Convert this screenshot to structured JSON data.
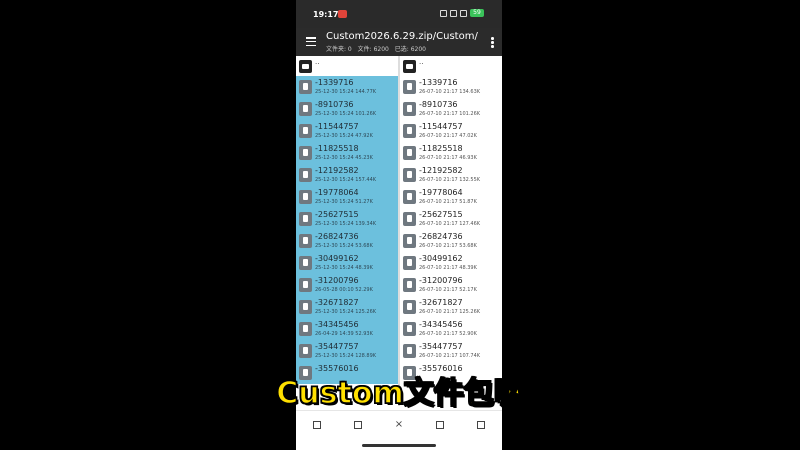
{
  "status_bar": {
    "time": "19:17",
    "battery": "59"
  },
  "app_bar": {
    "title": "Custom2026.6.29.zip/Custom/",
    "folders": "文件夹: 0",
    "files": "文件: 6200",
    "selected": "已选: 6200"
  },
  "left_pane": {
    "parent": "..",
    "files": [
      {
        "name": "-1339716",
        "meta": "25-12-30 15:24  144.77K"
      },
      {
        "name": "-8910736",
        "meta": "25-12-30 15:24  101.26K"
      },
      {
        "name": "-11544757",
        "meta": "25-12-30 15:24  47.92K"
      },
      {
        "name": "-11825518",
        "meta": "25-12-30 15:24  45.23K"
      },
      {
        "name": "-12192582",
        "meta": "25-12-30 15:24  157.44K"
      },
      {
        "name": "-19778064",
        "meta": "25-12-30 15:24  51.27K"
      },
      {
        "name": "-25627515",
        "meta": "25-12-30 15:24  139.34K"
      },
      {
        "name": "-26824736",
        "meta": "25-12-30 15:24  53.68K"
      },
      {
        "name": "-30499162",
        "meta": "25-12-30 15:24  48.39K"
      },
      {
        "name": "-31200796",
        "meta": "26-05-28 00:10  52.29K"
      },
      {
        "name": "-32671827",
        "meta": "25-12-30 15:24  125.26K"
      },
      {
        "name": "-34345456",
        "meta": "26-04-29 14:39  52.93K"
      },
      {
        "name": "-35447757",
        "meta": "25-12-30 15:24  128.89K"
      },
      {
        "name": "-35576016",
        "meta": ""
      }
    ]
  },
  "right_pane": {
    "parent": "..",
    "files": [
      {
        "name": "-1339716",
        "meta": "26-07-10 21:17  134.63K"
      },
      {
        "name": "-8910736",
        "meta": "26-07-10 21:17  101.26K"
      },
      {
        "name": "-11544757",
        "meta": "26-07-10 21:17  47.02K"
      },
      {
        "name": "-11825518",
        "meta": "26-07-10 21:17  46.93K"
      },
      {
        "name": "-12192582",
        "meta": "26-07-10 21:17  132.55K"
      },
      {
        "name": "-19778064",
        "meta": "26-07-10 21:17  51.87K"
      },
      {
        "name": "-25627515",
        "meta": "26-07-10 21:17  127.46K"
      },
      {
        "name": "-26824736",
        "meta": "26-07-10 21:17  53.68K"
      },
      {
        "name": "-30499162",
        "meta": "26-07-10 21:17  48.39K"
      },
      {
        "name": "-31200796",
        "meta": "26-07-10 21:17  52.17K"
      },
      {
        "name": "-32671827",
        "meta": "26-07-10 21:17  125.26K"
      },
      {
        "name": "-34345456",
        "meta": "26-07-10 21:17  52.90K"
      },
      {
        "name": "-35447757",
        "meta": "26-07-10 21:17  107.74K"
      },
      {
        "name": "-35576016",
        "meta": ""
      }
    ]
  },
  "toolbar": {
    "buttons": [
      "select-all-icon",
      "copy-icon",
      "close-icon",
      "compare-icon",
      "list-icon"
    ],
    "close_glyph": "×"
  },
  "caption": "Custom文件包嘛",
  "colors": {
    "selection": "#6cc0dd",
    "caption": "#ffe000",
    "appbar": "#2b2b2b"
  }
}
